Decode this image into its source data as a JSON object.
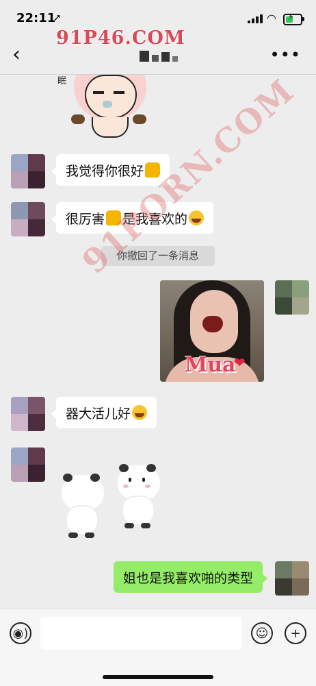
{
  "status_bar": {
    "time": "22:11",
    "location_icon": "location-arrow-icon",
    "signal_icon": "cellular-signal-icon",
    "wifi_icon": "wifi-icon",
    "battery_icon": "battery-charging-icon",
    "battery_level": 0.55
  },
  "header": {
    "back_icon": "chevron-left-icon",
    "title_obscured": true,
    "more_icon": "more-dots-icon"
  },
  "watermark": {
    "text": "91P46.COM",
    "diagonal_text": "91PORN.COM"
  },
  "messages": [
    {
      "side": "left",
      "type": "sticker",
      "content": "cartoon-girl-sticker",
      "partial_text": "眠"
    },
    {
      "side": "left",
      "type": "text",
      "text": "我觉得你很好",
      "emoji": "thumbs-up"
    },
    {
      "side": "left",
      "type": "text",
      "text": "很厉害",
      "emoji_mid": "thumbs-up",
      "text_after": "是我喜欢的",
      "emoji": "laughing-face"
    },
    {
      "side": "system",
      "type": "notice",
      "text": "你撤回了一条消息"
    },
    {
      "side": "right",
      "type": "image",
      "caption": "Mua"
    },
    {
      "side": "left",
      "type": "text",
      "text": "器大活儿好",
      "emoji": "laughing-face"
    },
    {
      "side": "left",
      "type": "sticker",
      "content": "white-bear-sticker"
    },
    {
      "side": "right",
      "type": "text",
      "text": "姐也是我喜欢啪的类型"
    }
  ],
  "input_bar": {
    "voice_icon": "voice-input-icon",
    "emoji_icon": "emoji-smile-icon",
    "plus_icon": "plus-icon",
    "placeholder": ""
  },
  "colors": {
    "chat_bg": "#ededed",
    "bubble_left": "#ffffff",
    "bubble_right": "#95ec69",
    "watermark": "#d94a59"
  }
}
